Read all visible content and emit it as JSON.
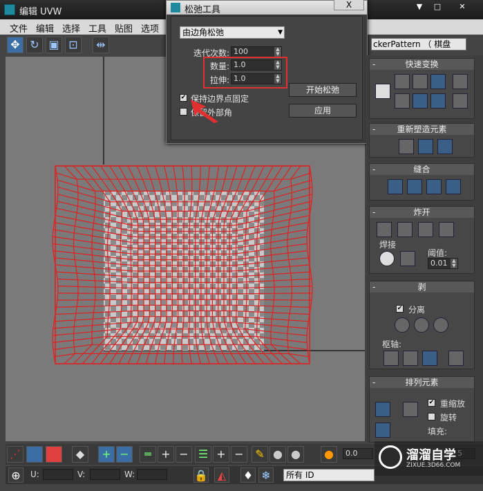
{
  "window": {
    "title": "编辑 UVW",
    "buttons": [
      "▼",
      "□",
      "✕"
    ]
  },
  "menu": [
    "文件",
    "编辑",
    "选择",
    "工具",
    "贴图",
    "选项"
  ],
  "pattern_field": "ckerPattern （ 棋盘",
  "dialog": {
    "title": "松弛工具",
    "close_label": "X",
    "mode_select": "由边角松弛",
    "iterations_label": "迭代次数:",
    "iterations_value": "100",
    "amount_label": "数量:",
    "amount_value": "1.0",
    "stretch_label": "拉伸:",
    "stretch_value": "1.0",
    "keep_boundary_label": "保持边界点固定",
    "keep_boundary_checked": true,
    "save_corners_label": "保留外部角",
    "save_corners_checked": false,
    "start_button": "开始松弛",
    "apply_button": "应用"
  },
  "panel": {
    "quick_transform": "快速变换",
    "reshape": "重新塑造元素",
    "stitch": "缝合",
    "explode": "炸开",
    "weld": "焊接",
    "threshold_label": "阈值:",
    "threshold_value": "0.01",
    "peel": "剥",
    "detach_label": "分离",
    "pivot_label": "枢轴:",
    "arrange": "排列元素",
    "rescale_label": "重缩放",
    "rotate_label": "旋转",
    "padding_label": "填充:",
    "collapse_marker": "-"
  },
  "bottom": {
    "value1": "0.0",
    "value2": "5"
  },
  "status": {
    "u_label": "U:",
    "v_label": "V:",
    "w_label": "W:",
    "id_select": "所有 ID"
  },
  "watermark": {
    "brand": "溜溜自学",
    "url": "ZIXUE.3D66.COM"
  },
  "colors": {
    "uv_mesh": "#e02020",
    "selection_box": "#e03030",
    "accent": "#3a6ea5"
  }
}
